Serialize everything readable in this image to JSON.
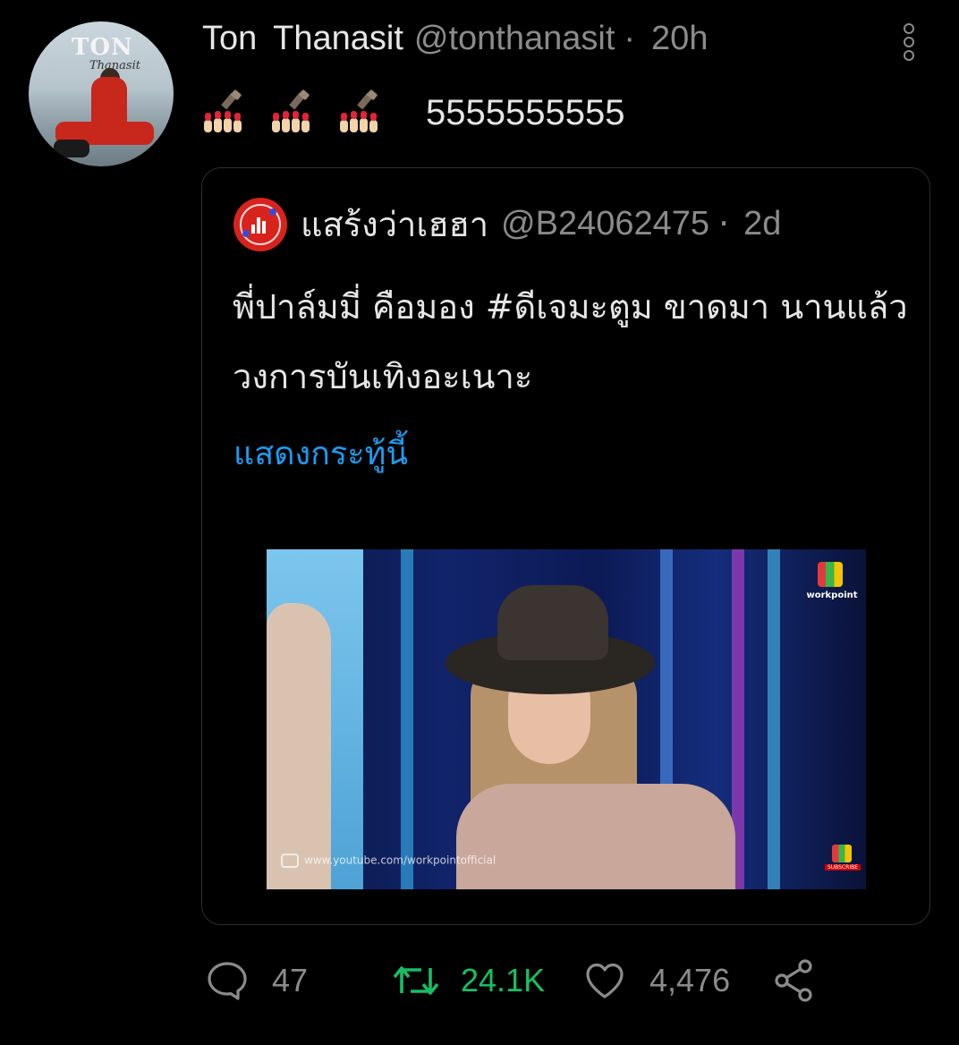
{
  "tweet": {
    "author": {
      "display_name": "Ton  Thanasit",
      "handle": "@tonthanasit",
      "avatar_text": "TON",
      "avatar_signature": "Thanasit"
    },
    "separator": "·",
    "time": "20h",
    "text": "5555555555",
    "emoji": [
      "lipstick-nails-emoji",
      "lipstick-nails-emoji",
      "lipstick-nails-emoji"
    ],
    "quoted": {
      "display_name": "แสร้งว่าเฮฮา",
      "handle": "@B24062475",
      "separator": "·",
      "time": "2d",
      "text": "พี่ปาล์มมี่  คือมอง #ดีเจมะตูม  ขาดมา นานแล้ว  วงการบันเทิงอะเนาะ",
      "show_thread_label": "แสดงกระทู้นี้",
      "video": {
        "channel_logo": "workpoint",
        "watermark": "www.youtube.com/workpointofficial",
        "subscribe_label": "SUBSCRIBE"
      }
    },
    "actions": {
      "replies": "47",
      "retweets": "24.1K",
      "likes": "4,476"
    }
  },
  "colors": {
    "background": "#000000",
    "text_primary": "#e6e6e6",
    "text_secondary": "#8b8b8b",
    "link": "#1d9bf0",
    "retweet_active": "#17bf63",
    "quote_avatar": "#d8231d"
  }
}
